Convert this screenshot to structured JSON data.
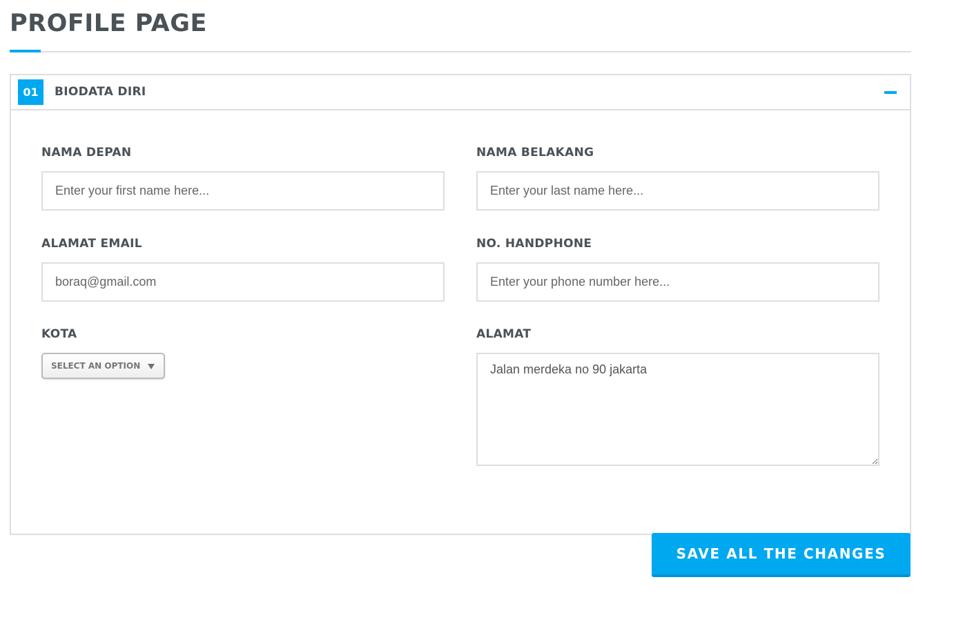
{
  "page": {
    "title": "PROFILE PAGE"
  },
  "section": {
    "number": "01",
    "title": "BIODATA DIRI",
    "collapse_icon": "minus-icon"
  },
  "form": {
    "first_name": {
      "label": "NAMA DEPAN",
      "value": "",
      "placeholder": "Enter your first name here..."
    },
    "last_name": {
      "label": "NAMA BELAKANG",
      "value": "",
      "placeholder": "Enter your last name here..."
    },
    "email": {
      "label": "ALAMAT EMAIL",
      "value": "",
      "placeholder": "boraq@gmail.com"
    },
    "phone": {
      "label": "NO. HANDPHONE",
      "value": "",
      "placeholder": "Enter your phone number here..."
    },
    "city": {
      "label": "KOTA",
      "selected": "SELECT AN OPTION",
      "arrow_icon": "triangle-down-icon"
    },
    "address": {
      "label": "ALAMAT",
      "value": "Jalan merdeka no 90 jakarta"
    }
  },
  "actions": {
    "save_label": "SAVE ALL THE CHANGES"
  },
  "colors": {
    "accent": "#00a8ef",
    "text": "#4a5258",
    "border": "#dcdfe1"
  }
}
